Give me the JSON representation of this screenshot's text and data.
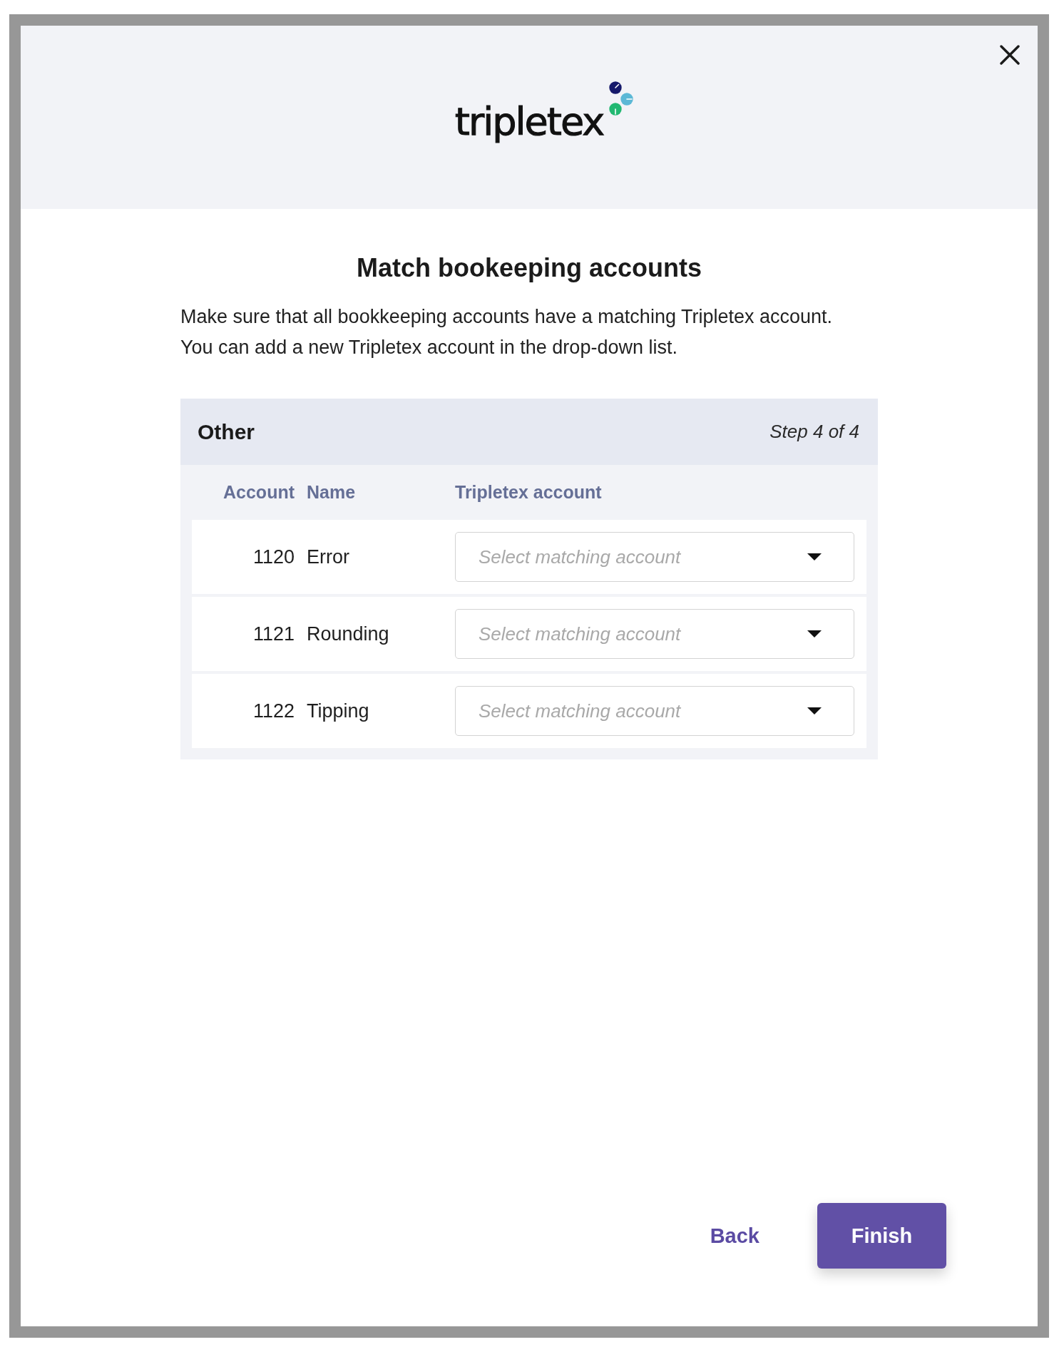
{
  "header": {
    "logo": "tripletex"
  },
  "title": "Match bookeeping accounts",
  "description": "Make sure that all bookkeeping accounts have a matching Tripletex account. You can add a new Tripletex account in the drop-down list.",
  "section": {
    "title": "Other",
    "step": "Step 4 of 4",
    "columns": [
      "Account",
      "Name",
      "Tripletex account"
    ],
    "rows": [
      {
        "account": "1120",
        "name": "Error",
        "select": {
          "placeholder": "Select matching account"
        }
      },
      {
        "account": "1121",
        "name": "Rounding",
        "select": {
          "placeholder": "Select matching account"
        }
      },
      {
        "account": "1122",
        "name": "Tipping",
        "select": {
          "placeholder": "Select matching account"
        }
      }
    ]
  },
  "buttons": [
    {
      "label": "Back",
      "kind": "link"
    },
    {
      "label": "Finish",
      "kind": "primary"
    }
  ]
}
